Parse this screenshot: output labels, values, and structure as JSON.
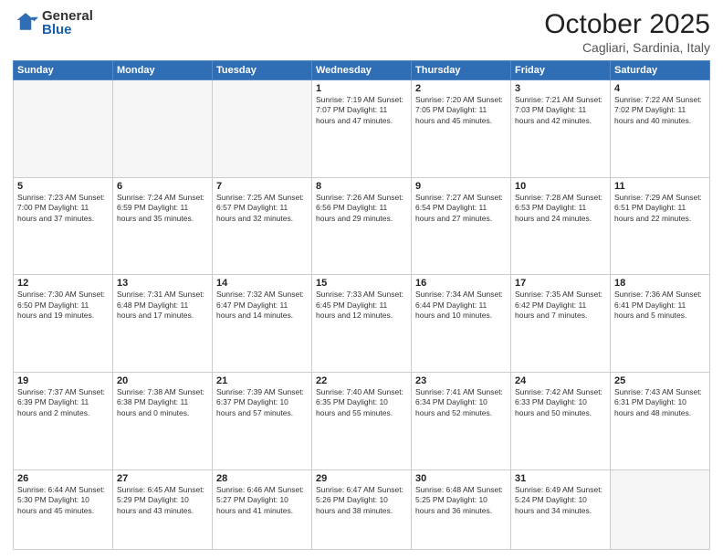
{
  "logo": {
    "general": "General",
    "blue": "Blue"
  },
  "title": "October 2025",
  "location": "Cagliari, Sardinia, Italy",
  "days_of_week": [
    "Sunday",
    "Monday",
    "Tuesday",
    "Wednesday",
    "Thursday",
    "Friday",
    "Saturday"
  ],
  "weeks": [
    [
      {
        "day": "",
        "info": ""
      },
      {
        "day": "",
        "info": ""
      },
      {
        "day": "",
        "info": ""
      },
      {
        "day": "1",
        "info": "Sunrise: 7:19 AM\nSunset: 7:07 PM\nDaylight: 11 hours\nand 47 minutes."
      },
      {
        "day": "2",
        "info": "Sunrise: 7:20 AM\nSunset: 7:05 PM\nDaylight: 11 hours\nand 45 minutes."
      },
      {
        "day": "3",
        "info": "Sunrise: 7:21 AM\nSunset: 7:03 PM\nDaylight: 11 hours\nand 42 minutes."
      },
      {
        "day": "4",
        "info": "Sunrise: 7:22 AM\nSunset: 7:02 PM\nDaylight: 11 hours\nand 40 minutes."
      }
    ],
    [
      {
        "day": "5",
        "info": "Sunrise: 7:23 AM\nSunset: 7:00 PM\nDaylight: 11 hours\nand 37 minutes."
      },
      {
        "day": "6",
        "info": "Sunrise: 7:24 AM\nSunset: 6:59 PM\nDaylight: 11 hours\nand 35 minutes."
      },
      {
        "day": "7",
        "info": "Sunrise: 7:25 AM\nSunset: 6:57 PM\nDaylight: 11 hours\nand 32 minutes."
      },
      {
        "day": "8",
        "info": "Sunrise: 7:26 AM\nSunset: 6:56 PM\nDaylight: 11 hours\nand 29 minutes."
      },
      {
        "day": "9",
        "info": "Sunrise: 7:27 AM\nSunset: 6:54 PM\nDaylight: 11 hours\nand 27 minutes."
      },
      {
        "day": "10",
        "info": "Sunrise: 7:28 AM\nSunset: 6:53 PM\nDaylight: 11 hours\nand 24 minutes."
      },
      {
        "day": "11",
        "info": "Sunrise: 7:29 AM\nSunset: 6:51 PM\nDaylight: 11 hours\nand 22 minutes."
      }
    ],
    [
      {
        "day": "12",
        "info": "Sunrise: 7:30 AM\nSunset: 6:50 PM\nDaylight: 11 hours\nand 19 minutes."
      },
      {
        "day": "13",
        "info": "Sunrise: 7:31 AM\nSunset: 6:48 PM\nDaylight: 11 hours\nand 17 minutes."
      },
      {
        "day": "14",
        "info": "Sunrise: 7:32 AM\nSunset: 6:47 PM\nDaylight: 11 hours\nand 14 minutes."
      },
      {
        "day": "15",
        "info": "Sunrise: 7:33 AM\nSunset: 6:45 PM\nDaylight: 11 hours\nand 12 minutes."
      },
      {
        "day": "16",
        "info": "Sunrise: 7:34 AM\nSunset: 6:44 PM\nDaylight: 11 hours\nand 10 minutes."
      },
      {
        "day": "17",
        "info": "Sunrise: 7:35 AM\nSunset: 6:42 PM\nDaylight: 11 hours\nand 7 minutes."
      },
      {
        "day": "18",
        "info": "Sunrise: 7:36 AM\nSunset: 6:41 PM\nDaylight: 11 hours\nand 5 minutes."
      }
    ],
    [
      {
        "day": "19",
        "info": "Sunrise: 7:37 AM\nSunset: 6:39 PM\nDaylight: 11 hours\nand 2 minutes."
      },
      {
        "day": "20",
        "info": "Sunrise: 7:38 AM\nSunset: 6:38 PM\nDaylight: 11 hours\nand 0 minutes."
      },
      {
        "day": "21",
        "info": "Sunrise: 7:39 AM\nSunset: 6:37 PM\nDaylight: 10 hours\nand 57 minutes."
      },
      {
        "day": "22",
        "info": "Sunrise: 7:40 AM\nSunset: 6:35 PM\nDaylight: 10 hours\nand 55 minutes."
      },
      {
        "day": "23",
        "info": "Sunrise: 7:41 AM\nSunset: 6:34 PM\nDaylight: 10 hours\nand 52 minutes."
      },
      {
        "day": "24",
        "info": "Sunrise: 7:42 AM\nSunset: 6:33 PM\nDaylight: 10 hours\nand 50 minutes."
      },
      {
        "day": "25",
        "info": "Sunrise: 7:43 AM\nSunset: 6:31 PM\nDaylight: 10 hours\nand 48 minutes."
      }
    ],
    [
      {
        "day": "26",
        "info": "Sunrise: 6:44 AM\nSunset: 5:30 PM\nDaylight: 10 hours\nand 45 minutes."
      },
      {
        "day": "27",
        "info": "Sunrise: 6:45 AM\nSunset: 5:29 PM\nDaylight: 10 hours\nand 43 minutes."
      },
      {
        "day": "28",
        "info": "Sunrise: 6:46 AM\nSunset: 5:27 PM\nDaylight: 10 hours\nand 41 minutes."
      },
      {
        "day": "29",
        "info": "Sunrise: 6:47 AM\nSunset: 5:26 PM\nDaylight: 10 hours\nand 38 minutes."
      },
      {
        "day": "30",
        "info": "Sunrise: 6:48 AM\nSunset: 5:25 PM\nDaylight: 10 hours\nand 36 minutes."
      },
      {
        "day": "31",
        "info": "Sunrise: 6:49 AM\nSunset: 5:24 PM\nDaylight: 10 hours\nand 34 minutes."
      },
      {
        "day": "",
        "info": ""
      }
    ]
  ]
}
